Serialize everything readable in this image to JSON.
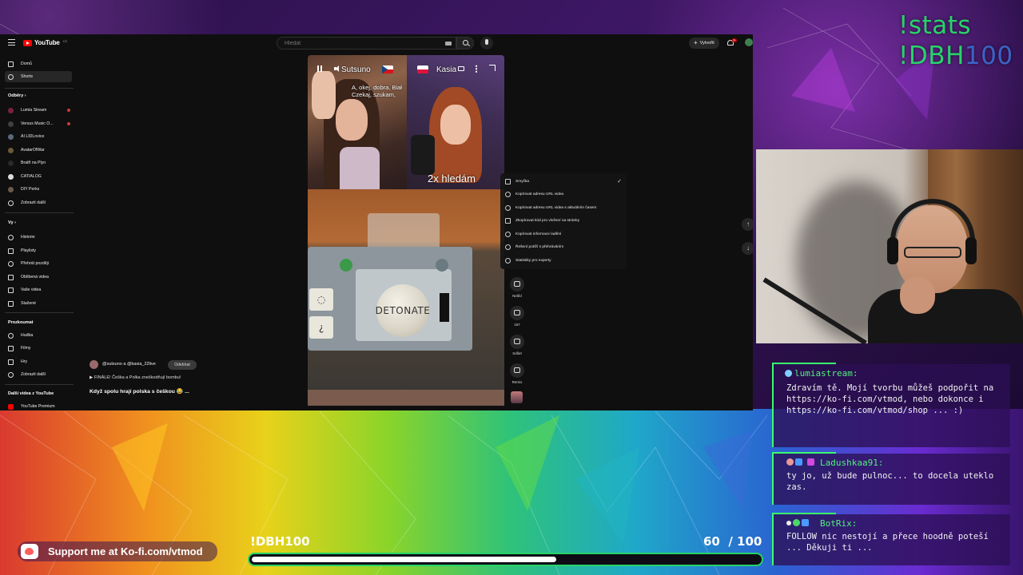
{
  "overlay": {
    "stats_command": "!stats",
    "dbh_command_prefix": "!DBH",
    "dbh_command_suffix": "100",
    "support_text": "Support me at Ko-fi.com/vtmod",
    "progress": {
      "label": "!DBH100",
      "current": "60",
      "separator": "/",
      "total": "100",
      "fraction": 0.6
    },
    "colors": {
      "accent_green": "#28d36a",
      "chat_bg": "#2c1054",
      "progress_border": "#27d267"
    }
  },
  "youtube": {
    "logo_text": "YouTube",
    "logo_country": "CZ",
    "search": {
      "placeholder": "Hledat"
    },
    "create_label": "Vytvořit",
    "notification_count": "9+",
    "sidebar": {
      "main": [
        {
          "label": "Domů",
          "icon": "home-icon"
        },
        {
          "label": "Shorts",
          "icon": "shorts-icon",
          "active": true
        }
      ],
      "subscriptions_title": "Odběry",
      "subscriptions": [
        {
          "label": "Lumia Stream",
          "live": true
        },
        {
          "label": "Versus Music O...",
          "live": true
        },
        {
          "label": "AI LIDLovice",
          "live": false
        },
        {
          "label": "AvatarOfWar",
          "live": false
        },
        {
          "label": "Bratři na Plyn",
          "live": false
        },
        {
          "label": "CATIALOG",
          "live": false
        },
        {
          "label": "DIY Perks",
          "live": false
        },
        {
          "label": "Zobrazit další",
          "live": false
        }
      ],
      "you_title": "Vy",
      "you": [
        {
          "label": "Historie",
          "icon": "history-icon"
        },
        {
          "label": "Playlisty",
          "icon": "playlist-icon"
        },
        {
          "label": "Přehrát později",
          "icon": "watch-later-icon"
        },
        {
          "label": "Oblíbená videa",
          "icon": "like-icon"
        },
        {
          "label": "Vaše videa",
          "icon": "video-icon"
        },
        {
          "label": "Stažené",
          "icon": "download-icon"
        }
      ],
      "explore_title": "Prozkoumat",
      "explore": [
        {
          "label": "Hudba",
          "icon": "music-icon"
        },
        {
          "label": "Filmy",
          "icon": "film-icon"
        },
        {
          "label": "Hry",
          "icon": "game-icon"
        },
        {
          "label": "Zobrazit další",
          "icon": "chevron-down-icon"
        }
      ],
      "more_title": "Další videa z YouTube",
      "more": [
        {
          "label": "YouTube Premium",
          "icon": "youtube-premium-icon"
        }
      ]
    },
    "short": {
      "channel": "@sutsuno a @kasia_22live",
      "subscribe_label": "Odebírat",
      "subtitle": "FINÁLE! Češka a Polka zneškodňují bombu!",
      "title": "Když spolu hrají polska s češkou 😂 ...",
      "overlay_name_left": "Sutsuno",
      "overlay_name_right": "Kasia",
      "caption_line1": "A, okej, dobra. Biał",
      "caption_line2": "Czekaj, szukam,",
      "highlight_caption": "2x hledám",
      "detonate_label": "DETONATE",
      "slot_top": "◌",
      "slot_bottom": "¿"
    },
    "context_menu": [
      {
        "label": "Smyčka",
        "icon": "loop-icon",
        "checked": true
      },
      {
        "label": "Kopírovat adresu URL videa",
        "icon": "link-icon"
      },
      {
        "label": "Kopírovat adresu URL videa s aktuálním časem",
        "icon": "link-icon"
      },
      {
        "label": "Zkopírovat kód pro vložení na stránky",
        "icon": "embed-icon"
      },
      {
        "label": "Kopírovat informace ladění",
        "icon": "debug-icon"
      },
      {
        "label": "Řešení potíží s přehráváním",
        "icon": "help-icon"
      },
      {
        "label": "Statistiky pro experty",
        "icon": "info-icon"
      }
    ],
    "actions": [
      {
        "label": "Nelíbí",
        "icon": "dislike-icon"
      },
      {
        "label": "167",
        "icon": "comment-icon"
      },
      {
        "label": "Sdílet",
        "icon": "share-icon"
      },
      {
        "label": "Remix",
        "icon": "remix-icon"
      }
    ]
  },
  "chat": [
    {
      "user": "lumiastream:",
      "message": "Zdravím tě. Mojí tvorbu můžeš podpořit na https://ko-fi.com/vtmod, nebo dokonce i https://ko-fi.com/vtmod/shop ... :)"
    },
    {
      "user": "Ladushkaa91:",
      "message": "ty jo, už bude pulnoc... to docela uteklo zas."
    },
    {
      "user": "BotRix:",
      "message": "FOLLOW nic nestojí a přece hoodně poteší ... Děkuji ti ..."
    }
  ]
}
